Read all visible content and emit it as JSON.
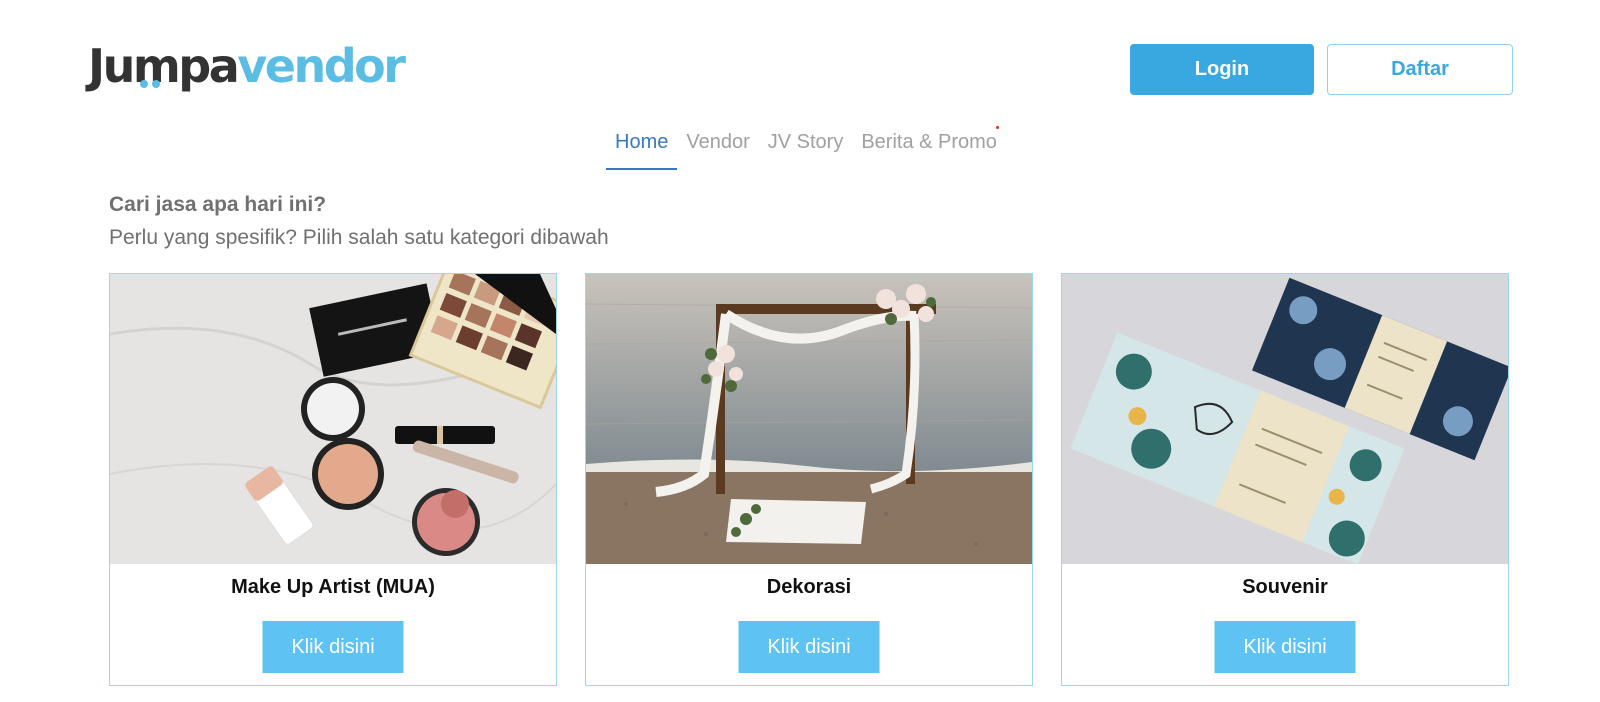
{
  "header": {
    "logo_part1": "Jumpa",
    "logo_part2": "vendor",
    "login_label": "Login",
    "register_label": "Daftar"
  },
  "nav": {
    "items": [
      {
        "label": "Home",
        "active": true
      },
      {
        "label": "Vendor",
        "active": false
      },
      {
        "label": "JV Story",
        "active": false
      },
      {
        "label": "Berita & Promo",
        "active": false
      }
    ]
  },
  "main": {
    "heading": "Cari jasa apa hari ini?",
    "subheading": "Perlu yang spesifik? Pilih salah satu kategori dibawah",
    "cards": [
      {
        "title": "Make Up Artist (MUA)",
        "button": "Klik disini"
      },
      {
        "title": "Dekorasi",
        "button": "Klik disini"
      },
      {
        "title": "Souvenir",
        "button": "Klik disini"
      }
    ]
  },
  "colors": {
    "brand_blue": "#3aa8e0",
    "card_button": "#5ec3f2",
    "nav_active": "#3a78c2",
    "logo_dark": "#333333",
    "logo_light": "#5bbde4"
  }
}
